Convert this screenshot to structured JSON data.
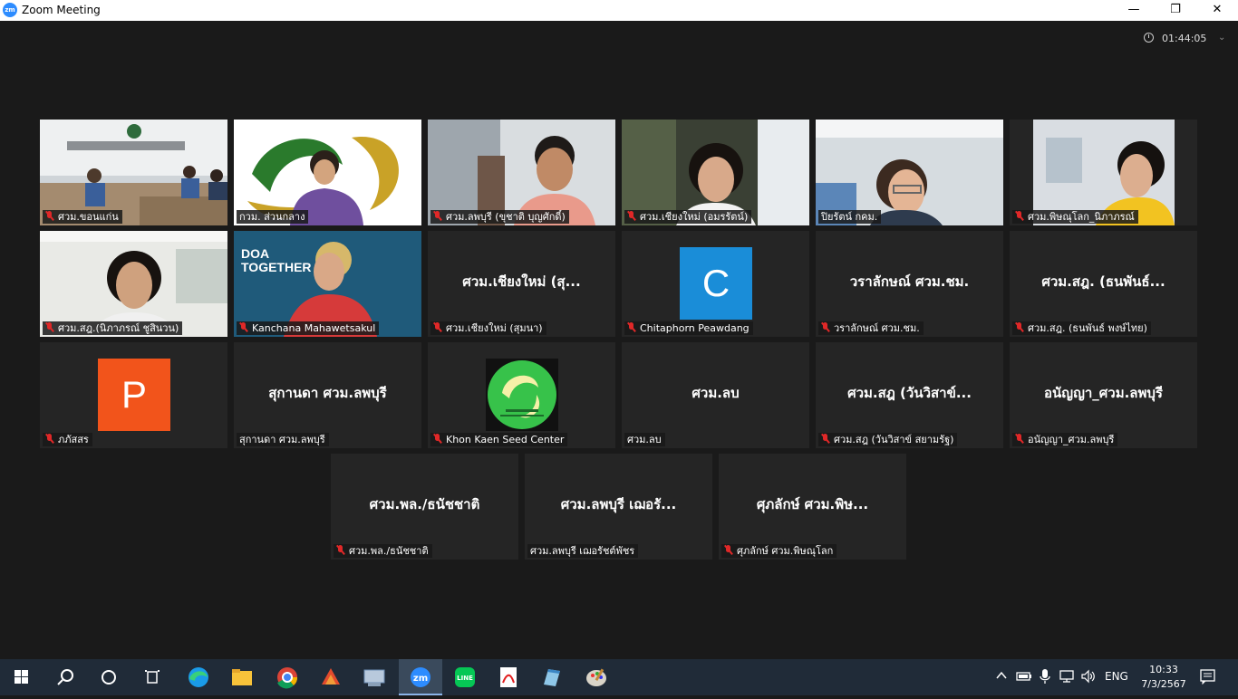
{
  "window": {
    "title": "Zoom Meeting",
    "minimize": "—",
    "maximize": "❐",
    "close": "✕"
  },
  "meeting": {
    "elapsed": "01:44:05"
  },
  "tiles": [
    {
      "label": "ศวม.ขอนแก่น"
    },
    {
      "label": "กวม. ส่วนกลาง"
    },
    {
      "label": "ศวม.ลพบุรี (ขุชาติ บุญศักดิ์)"
    },
    {
      "label": "ศวม.เชียงใหม่ (อมรรัตน์)"
    },
    {
      "label": "ปิยรัตน์ กคม."
    },
    {
      "label": "ศวม.พิษณุโลก_นิภาภรณ์"
    },
    {
      "label": "ศวม.สฎ.(นิภาภรณ์ ชูสินวน)"
    },
    {
      "label": "Kanchana Mahawetsakul",
      "overlay": "DOA TOGETHER"
    },
    {
      "label": "ศวม.เชียงใหม่ (สุมนา)",
      "display": "ศวม.เชียงใหม่ (สุ..."
    },
    {
      "label": "Chitaphorn Peawdang",
      "initial": "C",
      "color": "#1a8dd8"
    },
    {
      "label": "วราลักษณ์ ศวม.ชม.",
      "display": "วราลักษณ์ ศวม.ชม."
    },
    {
      "label": "ศวม.สฎ. (ธนพันธ์ พงษ์ไทย)",
      "display": "ศวม.สฎ. (ธนพันธ์..."
    },
    {
      "label": "ภภัสสร",
      "initial": "P",
      "color": "#f2541b"
    },
    {
      "label": "สุกานดา ศวม.ลพบุรี",
      "display": "สุกานดา ศวม.ลพบุรี"
    },
    {
      "label": "Khon Kaen Seed Center"
    },
    {
      "label": "ศวม.ลบ",
      "display": "ศวม.ลบ"
    },
    {
      "label": "ศวม.สฎ (วันวิสาข์ สยามรัฐ)",
      "display": "ศวม.สฎ (วันวิสาข์..."
    },
    {
      "label": "อนัญญา_ศวม.ลพบุรี",
      "display": "อนัญญา_ศวม.ลพบุรี"
    },
    {
      "label": "ศวม.พล./ธนัชชาติ",
      "display": "ศวม.พล./ธนัชชาติ"
    },
    {
      "label": "ศวม.ลพบุรี เฌอรัชต์พัชร",
      "display": "ศวม.ลพบุรี เฌอรั..."
    },
    {
      "label": "ศุภลักษ์ ศวม.พิษณุโลก",
      "display": "ศุภลักษ์ ศวม.พิษ..."
    }
  ],
  "taskbar": {
    "apps": [
      "start-icon",
      "search-icon",
      "task-view-icon",
      "widgets-icon",
      "edge-icon",
      "file-explorer-icon",
      "chrome-icon",
      "app-icon",
      "network-app-icon",
      "zoom-icon",
      "line-icon",
      "acrobat-icon",
      "notes-icon",
      "paint-icon"
    ],
    "language": "ENG",
    "time": "10:33",
    "date": "7/3/2567"
  },
  "colors": {
    "active_speaker": "#d7e93a",
    "mute": "#e02828",
    "taskbar": "#202b38",
    "background": "#1a1a1a"
  }
}
